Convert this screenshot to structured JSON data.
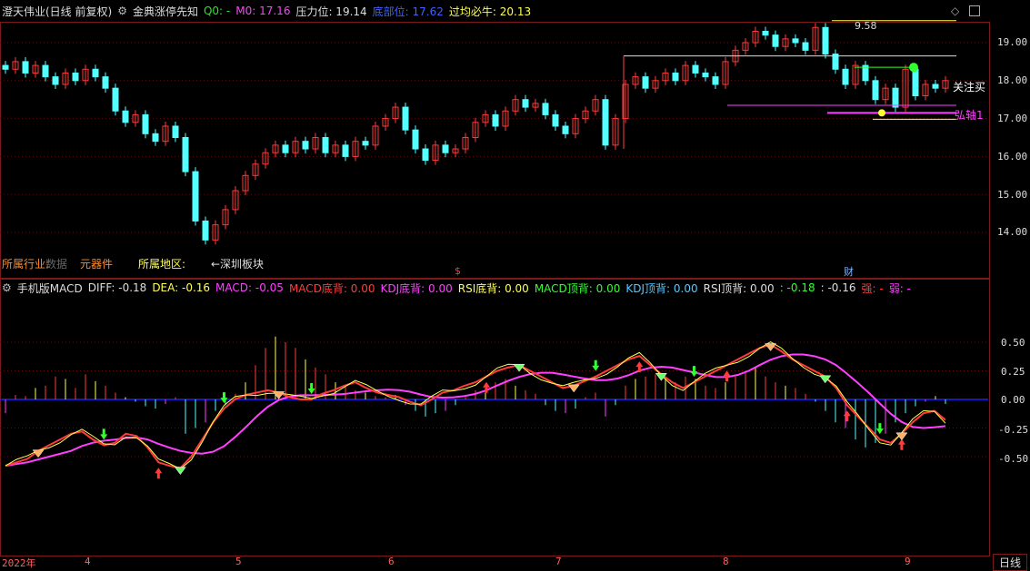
{
  "header": {
    "stock_name": "澄天伟业(日线 前复权)",
    "indicator_name": "金典涨停先知",
    "q0_label": "Q0: -",
    "m0_label": "M0: 17.16",
    "resistance_label": "压力位: 19.14",
    "bottom_label": "底部位: 17.62",
    "cross_label": "过均必牛: 20.13"
  },
  "price_axis": [
    "19.00",
    "18.00",
    "17.00",
    "16.00",
    "15.00",
    "14.00"
  ],
  "macd_axis": [
    "0.50",
    "0.25",
    "0.00",
    "-0.25",
    "-0.50"
  ],
  "price_annotations": {
    "high_value": "9.58",
    "focus_label": "关注买",
    "pivot_label": "弘轴1",
    "sector_label": "所属行业:",
    "sector_extra": "数据",
    "industry_value": "元器件",
    "region_label": "所属地区:",
    "region_value": "←深圳板块",
    "marker_dollar": "$",
    "marker_cai": "财"
  },
  "macd_header": {
    "name": "手机版MACD",
    "diff": "DIFF: -0.18",
    "dea": "DEA: -0.16",
    "macd": "MACD: -0.05",
    "macd_bottom": "MACD底背: 0.00",
    "kdj_bottom": "KDJ底背: 0.00",
    "rsi_bottom": "RSI底背: 0.00",
    "macd_top": "MACD顶背: 0.00",
    "kdj_top": "KDJ顶背: 0.00",
    "rsi_top": "RSI顶背: 0.00",
    "extra1": ": -0.18",
    "extra2": ": -0.16",
    "strong": "强: -",
    "weak": "弱: -"
  },
  "time_axis": [
    "2022年",
    "4",
    "5",
    "6",
    "7",
    "8",
    "9"
  ],
  "period_tab": "日线",
  "colors": {
    "up": "#ff3b3b",
    "down": "#54ffff",
    "diff": "#ffff50",
    "dea": "#ff40ff",
    "green": "#30ff30"
  }
}
